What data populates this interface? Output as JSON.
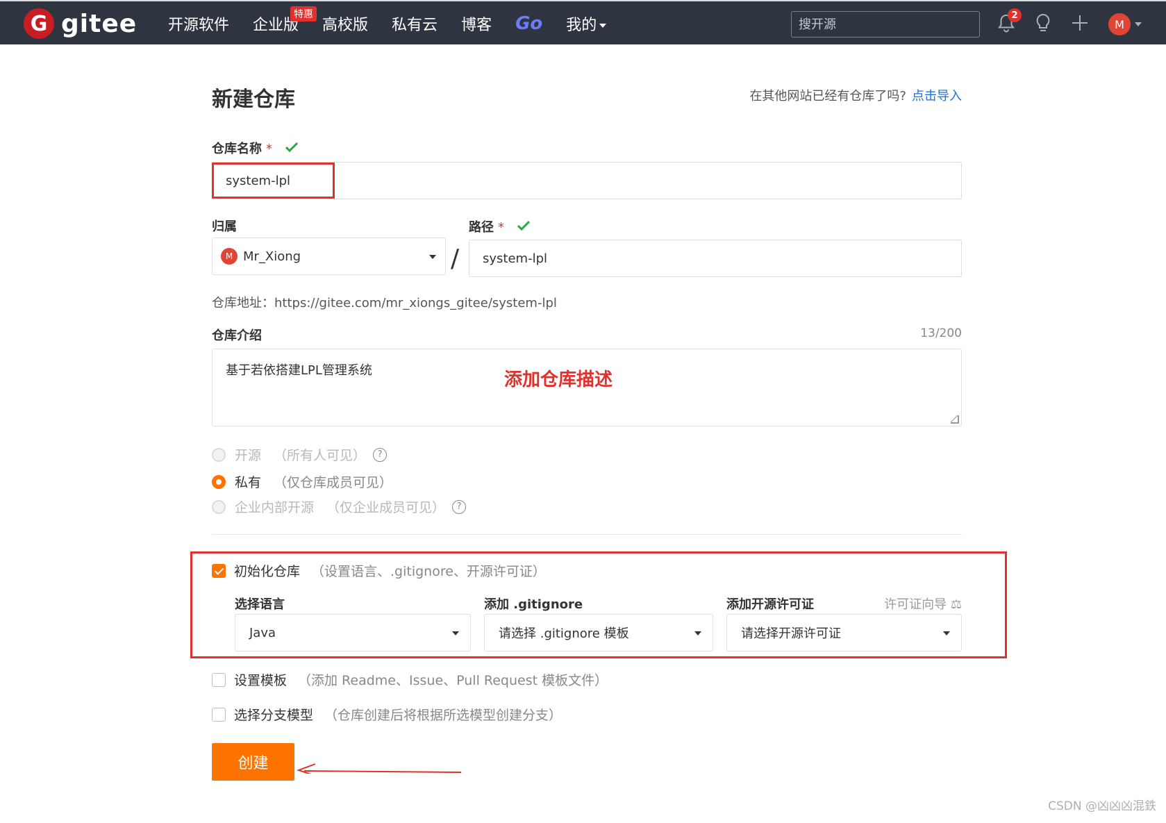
{
  "topbar": {
    "logo_mark": "G",
    "logo_text": "gitee",
    "nav": [
      "开源软件",
      "企业版",
      "高校版",
      "私有云",
      "博客",
      "Go",
      "我的"
    ],
    "promo_badge": "特惠",
    "search_placeholder": "搜开源",
    "notification_count": "2",
    "avatar_letter": "M"
  },
  "header": {
    "title": "新建仓库",
    "import_question": "在其他网站已经有仓库了吗?",
    "import_link": "点击导入"
  },
  "form": {
    "repo_name_label": "仓库名称",
    "required_mark": "*",
    "repo_name_value": "system-lpl",
    "owner_label": "归属",
    "owner_avatar": "M",
    "owner_value": "Mr_Xiong",
    "path_label": "路径",
    "path_separator": "/",
    "path_value": "system-lpl",
    "repo_url": "仓库地址：https://gitee.com/mr_xiongs_gitee/system-lpl",
    "desc_label": "仓库介绍",
    "desc_counter": "13/200",
    "desc_value": "基于若依搭建LPL管理系统",
    "annotation": "添加仓库描述",
    "visibility": [
      {
        "label": "开源",
        "sub": "（所有人可见）"
      },
      {
        "label": "私有",
        "sub": "（仅仓库成员可见）"
      },
      {
        "label": "企业内部开源",
        "sub": "（仅企业成员可见）"
      }
    ],
    "selected_visibility": "私有",
    "init_label": "初始化仓库",
    "init_sub": "（设置语言、.gitignore、开源许可证）",
    "language_label": "选择语言",
    "language_value": "Java",
    "gitignore_label": "添加 .gitignore",
    "gitignore_value": "请选择 .gitignore 模板",
    "license_label": "添加开源许可证",
    "license_guide": "许可证向导",
    "license_value": "请选择开源许可证",
    "template_label": "设置模板",
    "template_sub": "（添加 Readme、Issue、Pull Request 模板文件）",
    "branch_label": "选择分支模型",
    "branch_sub": "（仓库创建后将根据所选模型创建分支）",
    "submit_label": "创建"
  },
  "watermark": "CSDN @凶凶凶混鉄",
  "colors": {
    "accent": "#fe7300",
    "topbar": "#2f3540",
    "annotation": "#e0312d",
    "link": "#1e6fd9"
  }
}
